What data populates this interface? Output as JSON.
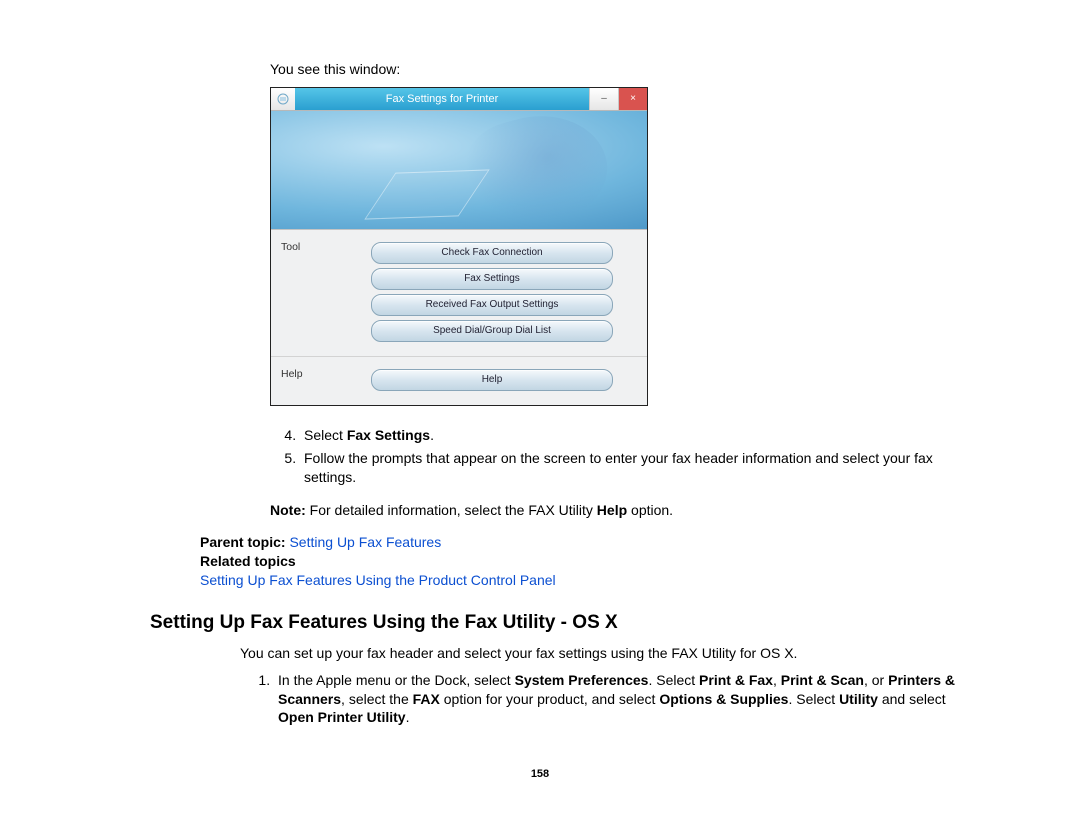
{
  "intro": "You see this window:",
  "window": {
    "title": "Fax Settings for Printer",
    "minimize": "–",
    "close": "×",
    "section_tool": "Tool",
    "section_help": "Help",
    "buttons": {
      "check": "Check Fax Connection",
      "settings": "Fax Settings",
      "received": "Received Fax Output Settings",
      "speed": "Speed Dial/Group Dial List",
      "help": "Help"
    }
  },
  "step4_pre": "Select ",
  "step4_bold": "Fax Settings",
  "step4_post": ".",
  "step5": "Follow the prompts that appear on the screen to enter your fax header information and select your fax settings.",
  "note_label": "Note:",
  "note_body": " For detailed information, select the FAX Utility ",
  "note_bold": "Help",
  "note_tail": " option.",
  "parent_label": "Parent topic: ",
  "parent_link": "Setting Up Fax Features",
  "related_label": "Related topics",
  "related_link": "Setting Up Fax Features Using the Product Control Panel",
  "heading": "Setting Up Fax Features Using the Fax Utility - OS X",
  "osx_intro": "You can set up your fax header and select your fax settings using the FAX Utility for OS X.",
  "osx_step1": {
    "a": "In the Apple menu or the Dock, select ",
    "b": "System Preferences",
    "c": ". Select ",
    "d": "Print & Fax",
    "e": ", ",
    "f": "Print & Scan",
    "g": ", or ",
    "h": "Printers & Scanners",
    "i": ", select the ",
    "j": "FAX",
    "k": " option for your product, and select ",
    "l": "Options & Supplies",
    "m": ". Select ",
    "n": "Utility",
    "o": " and select ",
    "p": "Open Printer Utility",
    "q": "."
  },
  "page": "158"
}
